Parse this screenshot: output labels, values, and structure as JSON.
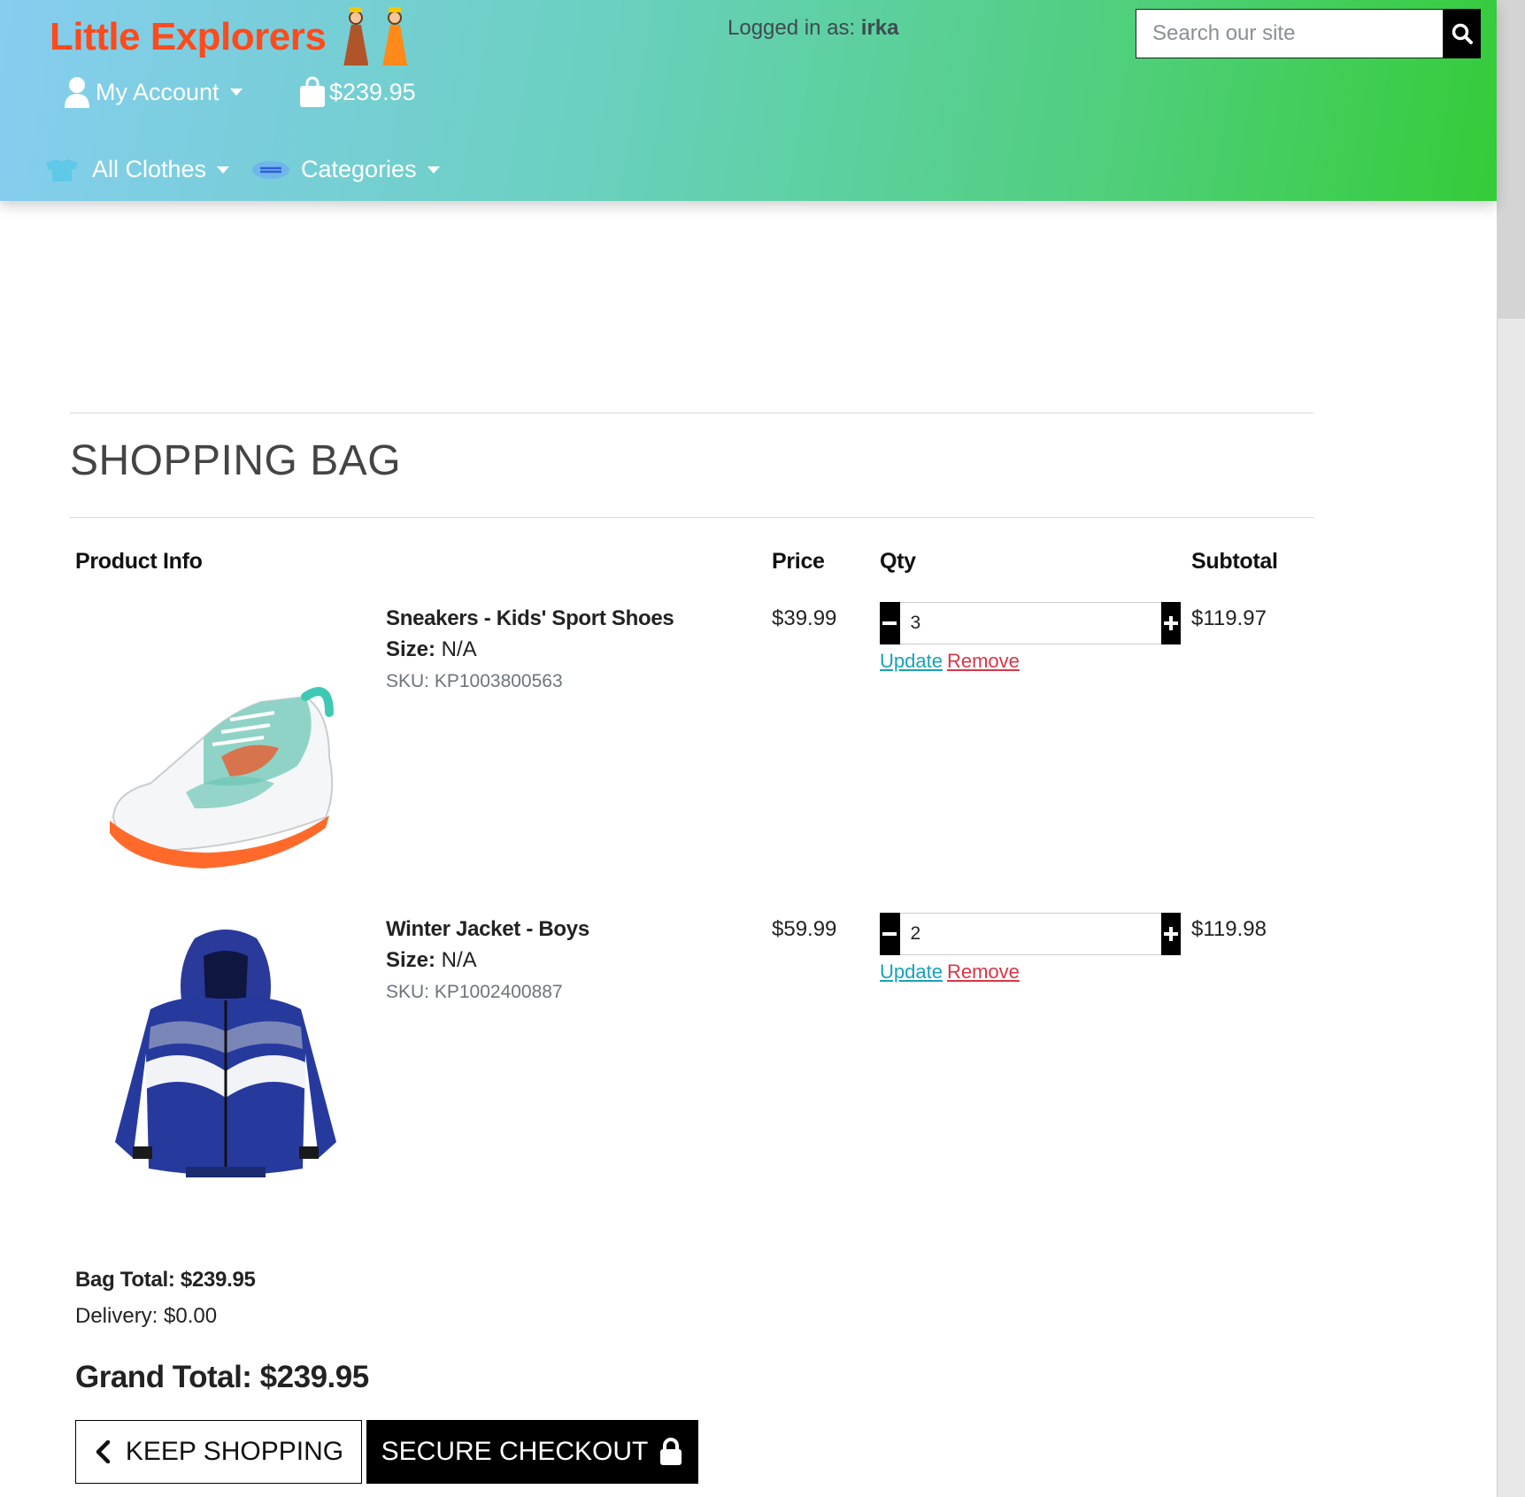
{
  "header": {
    "logo_text": "Little Explorers",
    "logged_in_prefix": "Logged in as: ",
    "username": "irka",
    "search_placeholder": "Search our site",
    "account_label": "My Account",
    "bag_total": "$239.95",
    "nav_clothes": "All Clothes",
    "nav_categories": "Categories"
  },
  "page_title": "SHOPPING BAG",
  "table_headers": {
    "product": "Product Info",
    "price": "Price",
    "qty": "Qty",
    "subtotal": "Subtotal"
  },
  "items": [
    {
      "name": "Sneakers - Kids' Sport Shoes",
      "size_label": "Size:",
      "size": " N/A",
      "sku": "SKU: KP1003800563",
      "price": "$39.99",
      "qty": "3",
      "subtotal": "$119.97",
      "update_label": "Update",
      "remove_label": "Remove"
    },
    {
      "name": "Winter Jacket - Boys",
      "size_label": "Size:",
      "size": " N/A",
      "sku": "SKU: KP1002400887",
      "price": "$59.99",
      "qty": "2",
      "subtotal": "$119.98",
      "update_label": "Update",
      "remove_label": "Remove"
    }
  ],
  "totals": {
    "bag_total": "Bag Total: $239.95",
    "delivery": "Delivery: $0.00",
    "grand_total": "Grand Total: $239.95"
  },
  "buttons": {
    "keep_shopping": "KEEP SHOPPING",
    "secure_checkout": "SECURE CHECKOUT"
  },
  "colors": {
    "brand": "#ff4a1c",
    "update_link": "#17a2b8",
    "remove_link": "#dc3545"
  }
}
